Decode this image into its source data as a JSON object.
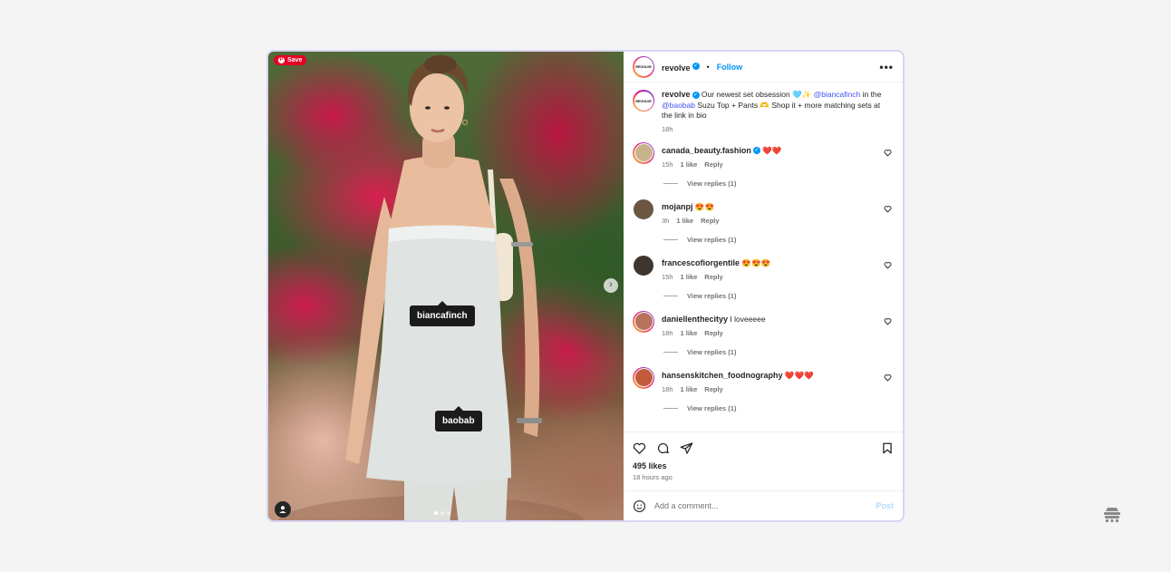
{
  "photo": {
    "save_label": "Save",
    "tags": [
      "biancafinch",
      "baobab"
    ],
    "carousel": {
      "count": 3,
      "active": 0
    }
  },
  "post": {
    "avatar_text": "REVOLVE",
    "username": "revolve",
    "dot": "•",
    "follow_label": "Follow",
    "more_label": "•••"
  },
  "caption": {
    "username": "revolve",
    "text_1": " Our newest set obsession 🩵✨ ",
    "mention_1": "@biancafinch",
    "text_2": " in the ",
    "mention_2": "@baobab",
    "text_3": " Suzu Top + Pants 🫶 Shop it + more matching sets at the link in bio",
    "time": "18h"
  },
  "comments": [
    {
      "username": "canada_beauty.fashion",
      "verified": true,
      "text": " ❤️❤️",
      "time": "15h",
      "likes": "1 like",
      "reply": "Reply",
      "view_replies": "View replies (1)",
      "avatar_color": "#c9b38a"
    },
    {
      "username": "mojanpj",
      "verified": false,
      "text": " 😍😍",
      "time": "3h",
      "likes": "1 like",
      "reply": "Reply",
      "view_replies": "View replies (1)",
      "avatar_color": "#6b5644"
    },
    {
      "username": "francescofiorgentile",
      "verified": false,
      "text": " 😍😍😍",
      "time": "15h",
      "likes": "1 like",
      "reply": "Reply",
      "view_replies": "View replies (1)",
      "avatar_color": "#3d3530"
    },
    {
      "username": "daniellenthecityy",
      "verified": false,
      "text": " I loveeeee",
      "time": "18h",
      "likes": "1 like",
      "reply": "Reply",
      "view_replies": "View replies (1)",
      "avatar_color": "#b8735a"
    },
    {
      "username": "hansenskitchen_foodnography",
      "verified": false,
      "text": " ❤️❤️❤️",
      "time": "18h",
      "likes": "1 like",
      "reply": "Reply",
      "view_replies": "View replies (1)",
      "avatar_color": "#c25a3c"
    }
  ],
  "engagement": {
    "likes": "495 likes",
    "ago": "18 hours ago"
  },
  "composer": {
    "placeholder": "Add a comment...",
    "post_label": "Post"
  },
  "colors": {
    "accent": "#0095f6",
    "mention": "#4150f7",
    "card_border": "#d9d4f3"
  }
}
